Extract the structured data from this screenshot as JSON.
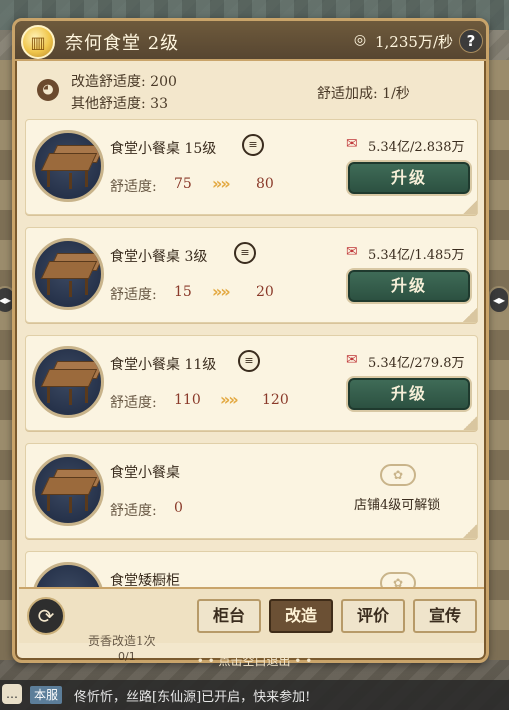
{
  "header": {
    "badge_glyph": "▥",
    "title": "奈何食堂 2级",
    "coin_icon": "coins-icon",
    "rate": "1,235万/秒",
    "help": "?"
  },
  "stats": {
    "face_glyph": "◕",
    "renovation_comfort": "改造舒适度: 200",
    "other_comfort": "其他舒适度: 33",
    "comfort_bonus": "舒适加成: 1/秒"
  },
  "items": [
    {
      "name": "食堂小餐桌 15级",
      "comfort_label": "舒适度:",
      "current": "75",
      "arrows": "»»",
      "next": "80",
      "cost": "5.34亿/2.838万",
      "button": "升级",
      "locked": false
    },
    {
      "name": "食堂小餐桌 3级",
      "comfort_label": "舒适度:",
      "current": "15",
      "arrows": "»»",
      "next": "20",
      "cost": "5.34亿/1.485万",
      "button": "升级",
      "locked": false
    },
    {
      "name": "食堂小餐桌 11级",
      "comfort_label": "舒适度:",
      "current": "110",
      "arrows": "»»",
      "next": "120",
      "cost": "5.34亿/279.8万",
      "button": "升级",
      "locked": false
    },
    {
      "name": "食堂小餐桌",
      "comfort_label": "舒适度:",
      "current": "0",
      "unlock_text": "店铺4级可解锁",
      "locked": true
    },
    {
      "name": "食堂矮橱柜"
    }
  ],
  "tabs": [
    {
      "label": "柜台",
      "active": false
    },
    {
      "label": "改造",
      "active": true
    },
    {
      "label": "评价",
      "active": false
    },
    {
      "label": "宣传",
      "active": false
    }
  ],
  "refresh_glyph": "⟳",
  "scene_sign": "贡香改造1次",
  "scene_count": "0/1",
  "hint": "• • 点击空白退出 • •",
  "chat": {
    "icon_glyph": "…",
    "server": "本服",
    "message": "佟忻忻，丝路[东仙源]已开启，快来参加!"
  },
  "side_arrow_glyph": "◂▸",
  "colors": {
    "panel_bg": "#f3e7cc",
    "header_bg": "#6e5a3c",
    "upgrade_button": "#3f6b57",
    "active_tab": "#6b5034",
    "value_red": "#8a3a2a",
    "arrow_gold": "#e3a942"
  }
}
